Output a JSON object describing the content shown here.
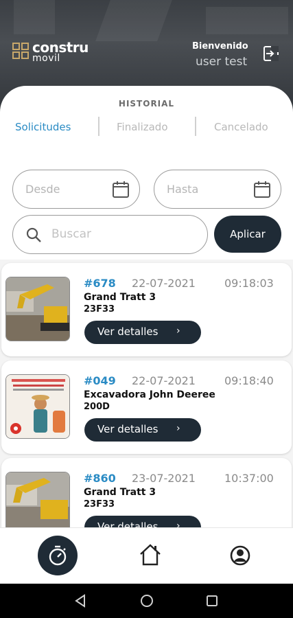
{
  "header": {
    "logo_line1": "constru",
    "logo_line2": "movil",
    "welcome": "Bienvenido",
    "username": "user test",
    "logout_icon": "logout-icon"
  },
  "section_title": "HISTORIAL",
  "tabs": [
    {
      "label": "Solicitudes",
      "active": true
    },
    {
      "label": "Finalizado",
      "active": false
    },
    {
      "label": "Cancelado",
      "active": false
    }
  ],
  "filters": {
    "from_placeholder": "Desde",
    "to_placeholder": "Hasta",
    "search_placeholder": "Buscar",
    "apply_label": "Aplicar"
  },
  "orders": [
    {
      "id": "#678",
      "date": "22-07-2021",
      "time": "09:18:03",
      "name": "Grand Tratt 3",
      "model": "23F33",
      "button": "Ver detalles",
      "thumb": "excavator-photo"
    },
    {
      "id": "#049",
      "date": "22-07-2021",
      "time": "09:18:40",
      "name": "Excavadora John Deeree",
      "model": "200D",
      "button": "Ver detalles",
      "thumb": "promo-flyer"
    },
    {
      "id": "#860",
      "date": "23-07-2021",
      "time": "10:37:00",
      "name": "Grand Tratt 3",
      "model": "23F33",
      "button": "Ver detalles",
      "thumb": "excavator-photo"
    }
  ],
  "bottom_nav": [
    {
      "icon": "stopwatch-icon",
      "active": true
    },
    {
      "icon": "home-icon",
      "active": false
    },
    {
      "icon": "profile-icon",
      "active": false
    }
  ],
  "colors": {
    "accent": "#2a8bc4",
    "dark": "#1f2b36",
    "brand_gold": "#c9a86a"
  }
}
